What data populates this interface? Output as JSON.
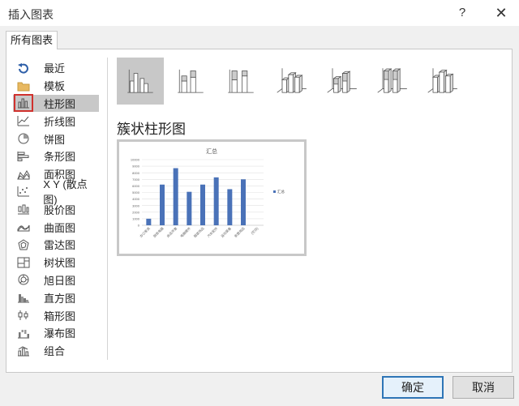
{
  "window": {
    "title": "插入图表",
    "help_label": "?",
    "close_label": "✕"
  },
  "tabs": [
    {
      "label": "所有图表"
    }
  ],
  "sidebar": {
    "items": [
      {
        "label": "最近",
        "icon": "recent-icon"
      },
      {
        "label": "模板",
        "icon": "folder-icon"
      },
      {
        "label": "柱形图",
        "icon": "column-chart-icon"
      },
      {
        "label": "折线图",
        "icon": "line-chart-icon"
      },
      {
        "label": "饼图",
        "icon": "pie-chart-icon"
      },
      {
        "label": "条形图",
        "icon": "bar-chart-icon"
      },
      {
        "label": "面积图",
        "icon": "area-chart-icon"
      },
      {
        "label": "X Y (散点图)",
        "icon": "scatter-chart-icon"
      },
      {
        "label": "股价图",
        "icon": "stock-chart-icon"
      },
      {
        "label": "曲面图",
        "icon": "surface-chart-icon"
      },
      {
        "label": "雷达图",
        "icon": "radar-chart-icon"
      },
      {
        "label": "树状图",
        "icon": "treemap-chart-icon"
      },
      {
        "label": "旭日图",
        "icon": "sunburst-chart-icon"
      },
      {
        "label": "直方图",
        "icon": "histogram-chart-icon"
      },
      {
        "label": "箱形图",
        "icon": "box-whisker-chart-icon"
      },
      {
        "label": "瀑布图",
        "icon": "waterfall-chart-icon"
      },
      {
        "label": "组合",
        "icon": "combo-chart-icon"
      }
    ],
    "selected_index": 2,
    "selection_outline_color": "#d0312d"
  },
  "subtypes": {
    "items": [
      {
        "icon": "clustered-column-icon"
      },
      {
        "icon": "stacked-column-icon"
      },
      {
        "icon": "100-stacked-column-icon"
      },
      {
        "icon": "3d-clustered-column-icon"
      },
      {
        "icon": "3d-stacked-column-icon"
      },
      {
        "icon": "3d-100-stacked-column-icon"
      },
      {
        "icon": "3d-column-icon"
      }
    ],
    "selected_index": 0
  },
  "subtype_title": "簇状柱形图",
  "chart_data": {
    "type": "bar",
    "title": "汇总",
    "categories": [
      "办公家具",
      "厨房电器",
      "床品件套",
      "电脑硬件",
      "服装饰品",
      "汽车配件",
      "运动装备",
      "家居用品",
      "(空白)"
    ],
    "series": [
      {
        "name": "汇总",
        "values": [
          1000,
          6200,
          8700,
          5100,
          6200,
          7300,
          5500,
          7000,
          0
        ],
        "color": "#4a72b8"
      }
    ],
    "ylim": [
      0,
      10000
    ],
    "yticks": [
      0,
      1000,
      2000,
      3000,
      4000,
      5000,
      6000,
      7000,
      8000,
      9000,
      10000
    ],
    "grid": true,
    "legend": "right"
  },
  "buttons": {
    "ok": "确定",
    "cancel": "取消"
  },
  "colors": {
    "accent": "#2e75b6",
    "bar": "#4a72b8"
  }
}
